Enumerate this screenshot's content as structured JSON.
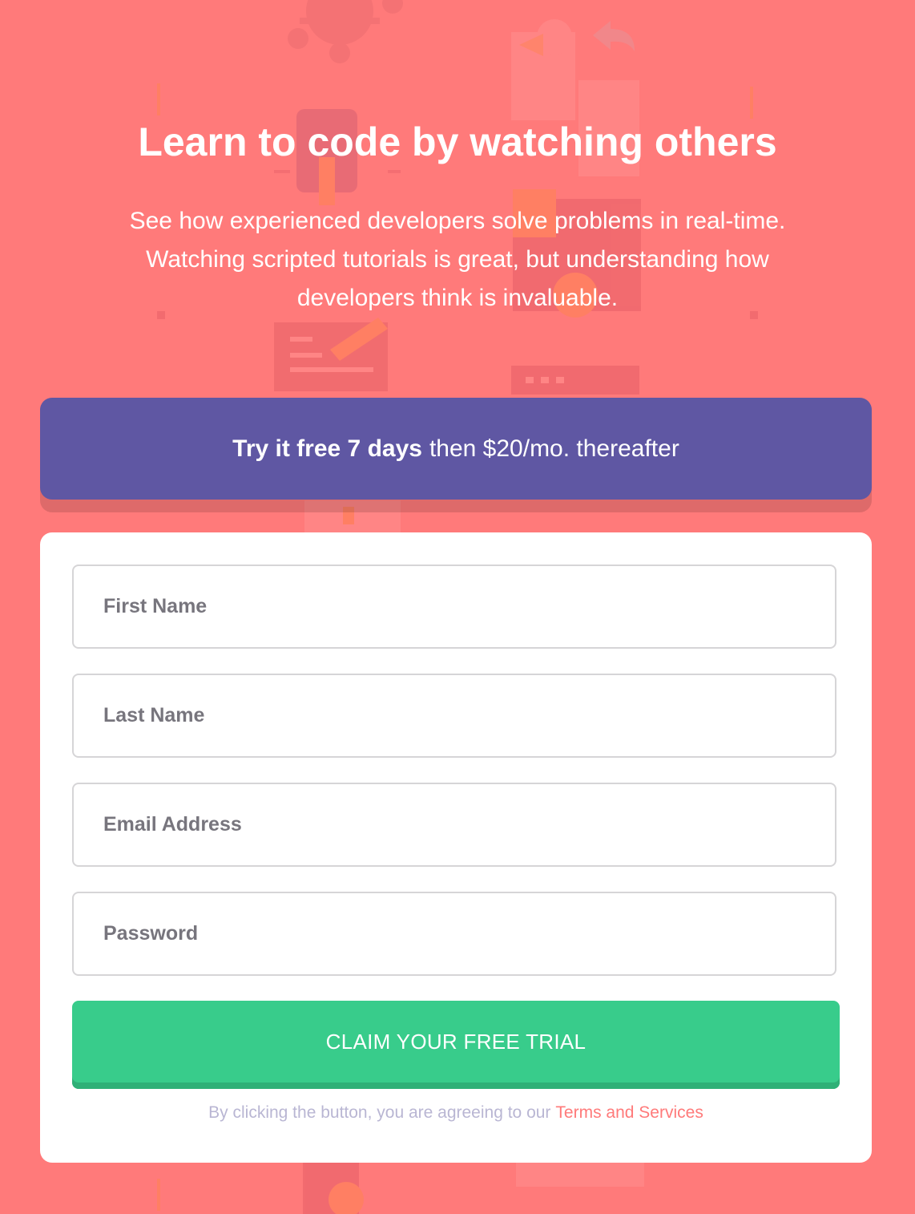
{
  "hero": {
    "title": "Learn to code by watching others",
    "description": "See how experienced developers solve problems in real-time. Watching scripted tutorials is great, but understanding how developers think is invaluable."
  },
  "promo": {
    "bold": "Try it free 7 days",
    "rest": "then $20/mo. thereafter"
  },
  "form": {
    "first_name_placeholder": "First Name",
    "last_name_placeholder": "Last Name",
    "email_placeholder": "Email Address",
    "password_placeholder": "Password",
    "submit_label": "CLAIM YOUR FREE TRIAL",
    "terms_text": "By clicking the button, you are agreeing to our",
    "terms_link": "Terms and Services"
  },
  "colors": {
    "background": "#ff7a7a",
    "promo": "#5f57a3",
    "button": "#38cc8b",
    "terms_text": "#b9b6d3",
    "link": "#ff7a7a"
  },
  "background_art_icons": [
    "network-icon",
    "chat-bubbles-icon",
    "phone-icon",
    "document-pencil-icon",
    "browser-window-icon"
  ]
}
